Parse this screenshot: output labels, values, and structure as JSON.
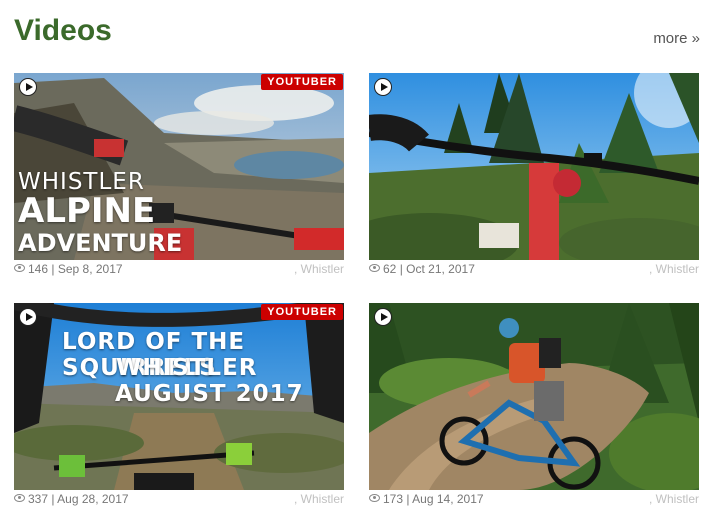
{
  "header": {
    "title": "Videos",
    "more_label": "more »"
  },
  "videos": [
    {
      "badge": "YOUTUBER",
      "overlay_lines": [
        "WHISTLER",
        "ALPINE",
        "ADVENTURE"
      ],
      "views": "146",
      "date": "Sep 8, 2017",
      "location": ", Whistler"
    },
    {
      "badge": "",
      "overlay_lines": [],
      "views": "62",
      "date": "Oct 21, 2017",
      "location": ", Whistler"
    },
    {
      "badge": "YOUTUBER",
      "overlay_lines": [
        "LORD OF THE SQUIRRELS",
        "WHISTLER",
        "AUGUST 2017"
      ],
      "views": "337",
      "date": "Aug 28, 2017",
      "location": ", Whistler"
    },
    {
      "badge": "",
      "overlay_lines": [],
      "views": "173",
      "date": "Aug 14, 2017",
      "location": ", Whistler"
    }
  ],
  "icons": {
    "play": "play-icon",
    "views": "eye-icon"
  },
  "colors": {
    "title": "#3b6a2b",
    "badge": "#cc0000",
    "meta": "#777777",
    "location": "#c0c0c0"
  }
}
